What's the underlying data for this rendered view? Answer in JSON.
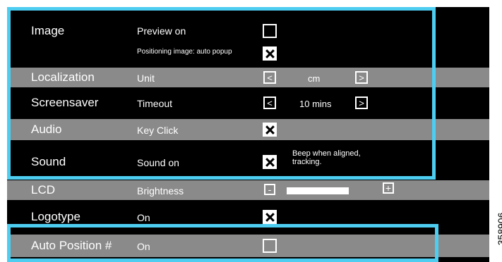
{
  "settings": {
    "image": {
      "category": "Image",
      "preview_label": "Preview on",
      "preview_checked": false,
      "positioning_label": "Positioning image: auto popup",
      "positioning_checked": true
    },
    "localization": {
      "category": "Localization",
      "label": "Unit",
      "value": "cm"
    },
    "screensaver": {
      "category": "Screensaver",
      "label": "Timeout",
      "value": "10 mins"
    },
    "audio": {
      "category": "Audio",
      "label": "Key Click",
      "checked": true
    },
    "sound": {
      "category": "Sound",
      "label": "Sound on",
      "checked": true,
      "note": "Beep when aligned, tracking."
    },
    "lcd": {
      "category": "LCD",
      "label": "Brightness",
      "decrease": "-",
      "increase": "+",
      "level": 0.6
    },
    "logotype": {
      "category": "Logotype",
      "label": "On",
      "checked": true
    },
    "auto_position": {
      "category": "Auto Position #",
      "label": "On",
      "checked": false
    }
  },
  "controls": {
    "prev_symbol": "<",
    "next_symbol": ">"
  },
  "figure_id": "358906",
  "colors": {
    "highlight": "#4dcdf0",
    "row_gray": "#8a8a8a",
    "background": "#000000"
  }
}
